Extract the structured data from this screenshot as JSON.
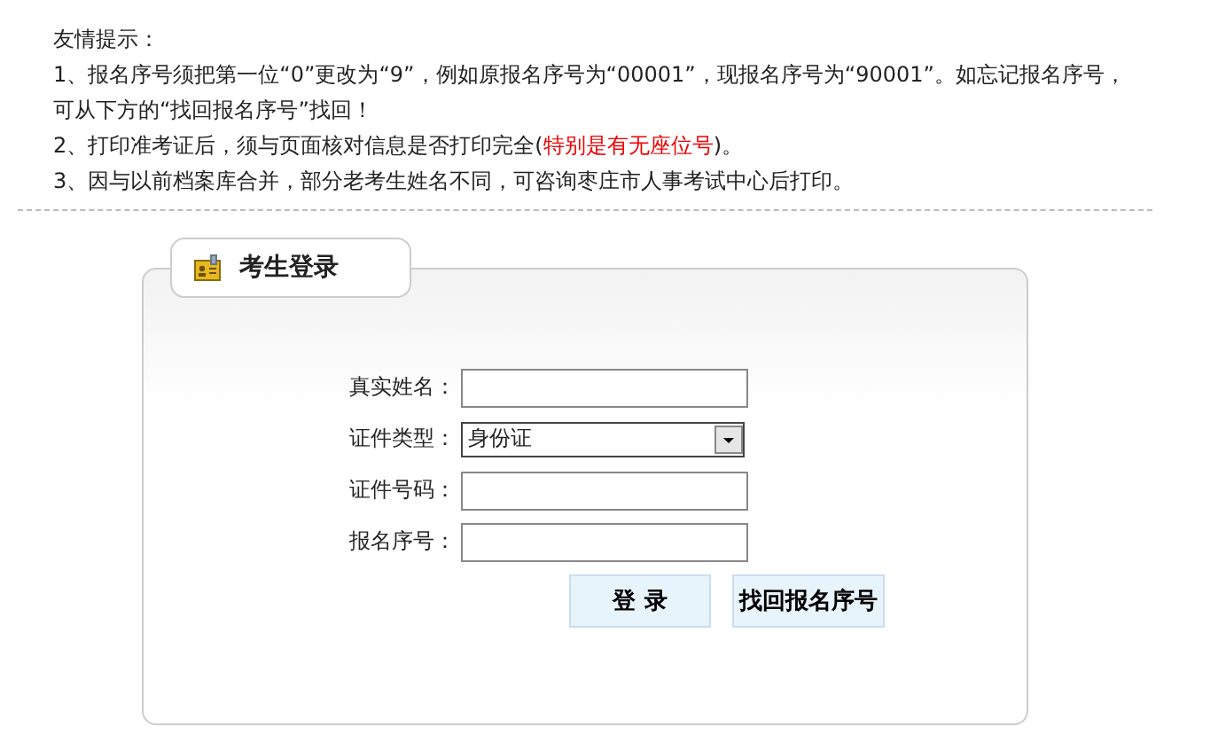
{
  "notice": {
    "title": "友情提示：",
    "items": [
      {
        "parts": [
          {
            "text": "1、报名序号须把第一位“0”更改为“9”，例如原报名序号为“00001”，现报名序号为“90001”。如忘记报名序号，可从下方的“找回报名序号”找回！",
            "emphasis": false
          }
        ]
      },
      {
        "parts": [
          {
            "text": "2、打印准考证后，须与页面核对信息是否打印完全(",
            "emphasis": false
          },
          {
            "text": "特别是有无座位号",
            "emphasis": true
          },
          {
            "text": ")。",
            "emphasis": false
          }
        ]
      },
      {
        "parts": [
          {
            "text": "3、因与以前档案库合并，部分老考生姓名不同，可咨询枣庄市人事考试中心后打印。",
            "emphasis": false
          }
        ]
      }
    ]
  },
  "login": {
    "title": "考生登录",
    "fields": [
      {
        "label": "真实姓名：",
        "kind": "text"
      },
      {
        "label": "证件类型：",
        "kind": "select",
        "value": "身份证"
      },
      {
        "label": "证件号码：",
        "kind": "text"
      },
      {
        "label": "报名序号：",
        "kind": "text"
      }
    ],
    "buttons": [
      "登 录",
      "找回报名序号"
    ]
  }
}
